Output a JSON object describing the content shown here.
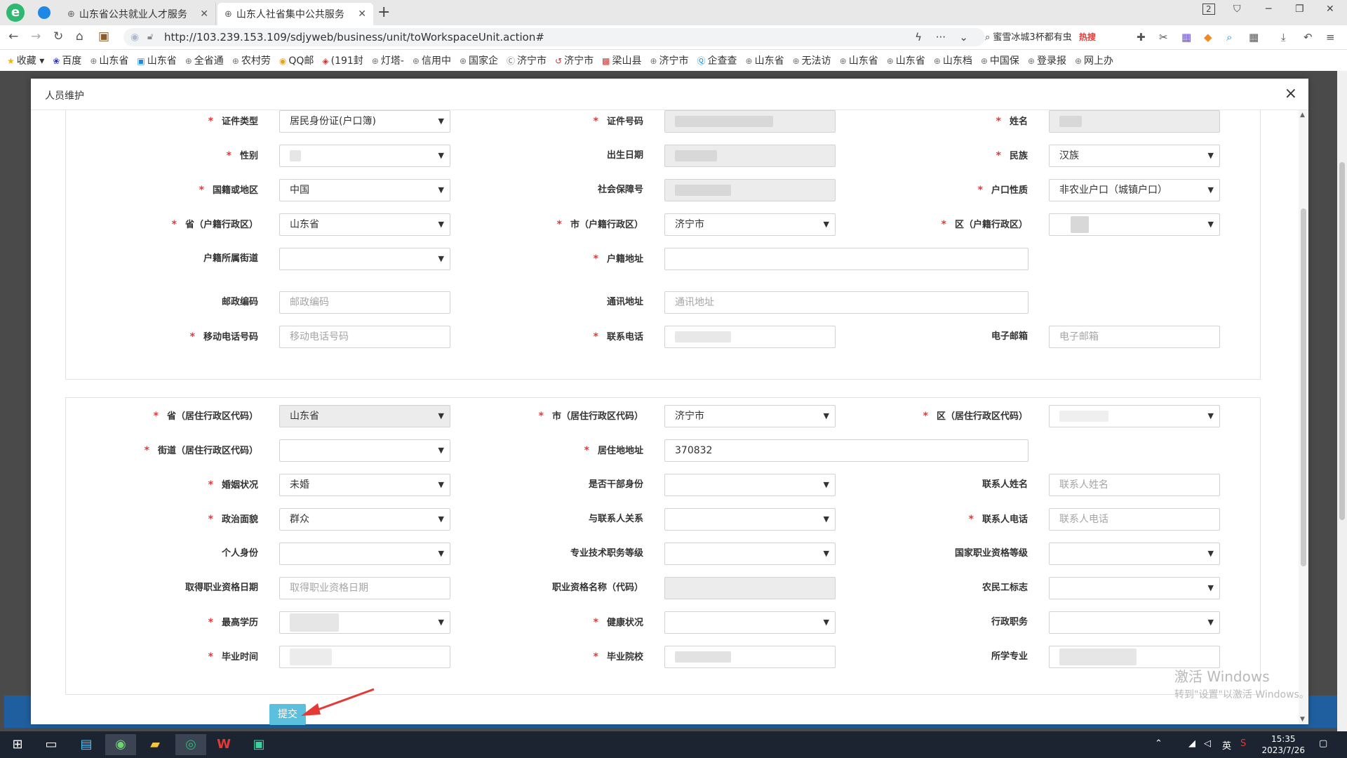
{
  "browser": {
    "tabs": [
      {
        "title": "山东省公共就业人才服务"
      },
      {
        "title": "山东人社省集中公共服务"
      }
    ],
    "new_tab": "+",
    "url": "http://103.239.153.109/sdjyweb/business/unit/toWorkspaceUnit.action#",
    "search_text": "蜜雪冰城3杯都有虫",
    "search_hot": "热搜",
    "tab_count": "2"
  },
  "bookmarks": [
    "收藏",
    "百度",
    "山东省",
    "山东省",
    "全省通",
    "农村劳",
    "QQ邮",
    "(191封",
    "灯塔-",
    "信用中",
    "国家企",
    "济宁市",
    "济宁市",
    "梁山县",
    "济宁市",
    "企查查",
    "山东省",
    "无法访",
    "山东省",
    "山东省",
    "山东档",
    "中国保",
    "登录报",
    "网上办"
  ],
  "modal": {
    "title": "人员维护",
    "close": "×",
    "submit": "提交"
  },
  "form1": {
    "id_type": {
      "label": "证件类型",
      "value": "居民身份证(户口簿)"
    },
    "id_number": {
      "label": "证件号码"
    },
    "name": {
      "label": "姓名"
    },
    "gender": {
      "label": "性别"
    },
    "birth_date": {
      "label": "出生日期"
    },
    "ethnicity": {
      "label": "民族",
      "value": "汉族"
    },
    "nationality": {
      "label": "国籍或地区",
      "value": "中国"
    },
    "social_security": {
      "label": "社会保障号"
    },
    "hukou_type": {
      "label": "户口性质",
      "value": "非农业户口（城镇户口）"
    },
    "hukou_province": {
      "label": "省（户籍行政区）",
      "value": "山东省"
    },
    "hukou_city": {
      "label": "市（户籍行政区）",
      "value": "济宁市"
    },
    "hukou_district": {
      "label": "区（户籍行政区）"
    },
    "hukou_street": {
      "label": "户籍所属街道"
    },
    "hukou_address": {
      "label": "户籍地址"
    },
    "postal_code": {
      "label": "邮政编码",
      "placeholder": "邮政编码"
    },
    "mail_address": {
      "label": "通讯地址",
      "placeholder": "通讯地址"
    },
    "mobile": {
      "label": "移动电话号码",
      "placeholder": "移动电话号码"
    },
    "contact_phone": {
      "label": "联系电话"
    },
    "email": {
      "label": "电子邮箱",
      "placeholder": "电子邮箱"
    }
  },
  "form2": {
    "res_province": {
      "label": "省（居住行政区代码）",
      "value": "山东省"
    },
    "res_city": {
      "label": "市（居住行政区代码）",
      "value": "济宁市"
    },
    "res_district": {
      "label": "区（居住行政区代码）"
    },
    "res_street": {
      "label": "街道（居住行政区代码）"
    },
    "res_address": {
      "label": "居住地地址",
      "value": "370832"
    },
    "marital": {
      "label": "婚姻状况",
      "value": "未婚"
    },
    "cadre": {
      "label": "是否干部身份"
    },
    "contact_name": {
      "label": "联系人姓名",
      "placeholder": "联系人姓名"
    },
    "political": {
      "label": "政治面貌",
      "value": "群众"
    },
    "relation": {
      "label": "与联系人关系"
    },
    "contact_tel": {
      "label": "联系人电话",
      "placeholder": "联系人电话"
    },
    "identity": {
      "label": "个人身份"
    },
    "tech_level": {
      "label": "专业技术职务等级"
    },
    "national_level": {
      "label": "国家职业资格等级"
    },
    "cert_date": {
      "label": "取得职业资格日期",
      "placeholder": "取得职业资格日期"
    },
    "cert_name": {
      "label": "职业资格名称（代码）"
    },
    "migrant": {
      "label": "农民工标志"
    },
    "education": {
      "label": "最高学历"
    },
    "health": {
      "label": "健康状况"
    },
    "admin_post": {
      "label": "行政职务"
    },
    "grad_time": {
      "label": "毕业时间"
    },
    "school": {
      "label": "毕业院校"
    },
    "major": {
      "label": "所学专业"
    }
  },
  "watermark": {
    "line1": "激活 Windows",
    "line2": "转到\"设置\"以激活 Windows。"
  },
  "taskbar": {
    "time": "15:35",
    "date": "2023/7/26",
    "ime": "英"
  }
}
